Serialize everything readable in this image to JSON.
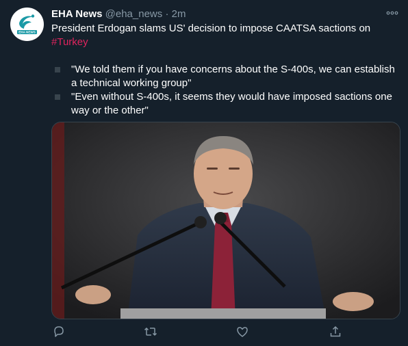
{
  "tweet": {
    "display_name": "EHA News",
    "handle": "@eha_news",
    "separator": "·",
    "time": "2m",
    "avatar_text": "EHA NEWS",
    "text_line1": "President Erdogan slams US' decision to impose CAATSA sactions on",
    "hashtag": "#Turkey",
    "quote1": "\"We told them if you have concerns about the S-400s, we can establish a technical working group\"",
    "quote2": "\"Even without S-400s, it seems they would have imposed sactions one way or the other\""
  },
  "actions": [
    {
      "icon": "reply-icon"
    },
    {
      "icon": "retweet-icon"
    },
    {
      "icon": "like-icon"
    },
    {
      "icon": "share-icon"
    }
  ],
  "colors": {
    "background": "#15202b",
    "text": "#ffffff",
    "muted": "#8899a6",
    "hashtag": "#e0245e",
    "border": "#38444d"
  }
}
